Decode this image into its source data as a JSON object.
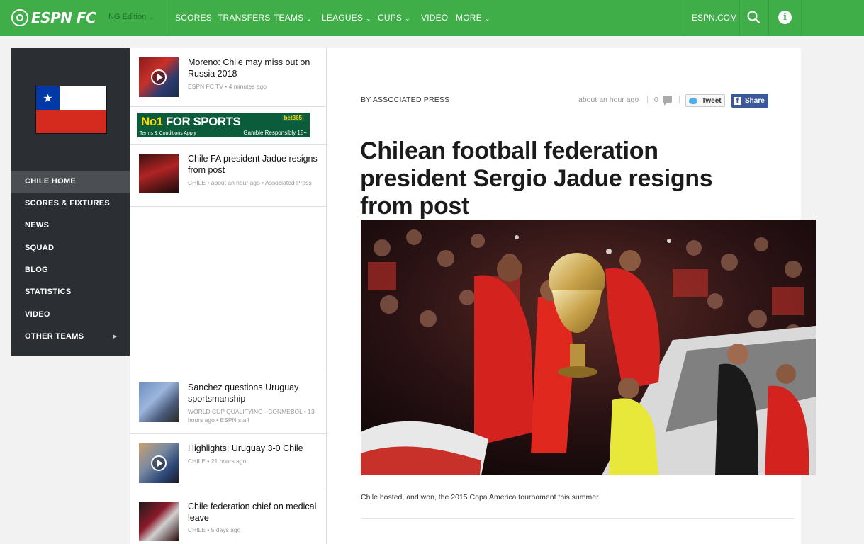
{
  "topbar": {
    "logo_text": "ESPN FC",
    "edition": "NG Edition",
    "nav": [
      {
        "label": "SCORES"
      },
      {
        "label": "TRANSFERS"
      },
      {
        "label": "TEAMS"
      },
      {
        "label": "LEAGUES"
      },
      {
        "label": "CUPS"
      },
      {
        "label": "VIDEO"
      },
      {
        "label": "MORE"
      }
    ],
    "espn_link": "ESPN.COM",
    "info_glyph": "i",
    "colors": {
      "brand": "#3fae49"
    }
  },
  "sidebar": {
    "flag": "Chile",
    "flag_star": "★",
    "items": [
      {
        "label": "CHILE HOME",
        "active": true
      },
      {
        "label": "SCORES & FIXTURES"
      },
      {
        "label": "NEWS"
      },
      {
        "label": "SQUAD"
      },
      {
        "label": "BLOG"
      },
      {
        "label": "STATISTICS"
      },
      {
        "label": "VIDEO"
      },
      {
        "label": "OTHER TEAMS"
      }
    ],
    "arrow_glyph": "▶"
  },
  "stories": [
    {
      "title": "Moreno: Chile may miss out on Russia 2018",
      "meta": "ESPN FC TV  • 4 minutes ago",
      "video": true
    },
    {
      "title": "Chile FA president Jadue resigns from post",
      "meta": "CHILE  • about an hour ago  • Associated Press",
      "video": false
    },
    {
      "title": "Sanchez questions Uruguay sportsmanship",
      "meta": "WORLD CUP QUALIFYING - CONMEBOL  • 13 hours ago  • ESPN staff",
      "video": false
    },
    {
      "title": "Highlights: Uruguay 3-0 Chile",
      "meta": "CHILE  • 21 hours ago",
      "video": true
    },
    {
      "title": "Chile federation chief on medical leave",
      "meta": "CHILE  • 5 days ago",
      "video": false
    }
  ],
  "ad": {
    "headline_a": "No1",
    "headline_b": " FOR SPORTS",
    "terms": "Terms & Conditions Apply",
    "brand": "bet365",
    "responsibly": "Gamble Responsibly 18+"
  },
  "article": {
    "byline": "BY ASSOCIATED PRESS",
    "timestamp": "about an hour ago",
    "comment_count": "0",
    "tweet_label": "Tweet",
    "share_label": "Share",
    "fb_glyph": "f",
    "headline": "Chilean football federation president Sergio Jadue resigns from post",
    "caption": "Chile hosted, and won, the 2015 Copa America tournament this summer."
  }
}
